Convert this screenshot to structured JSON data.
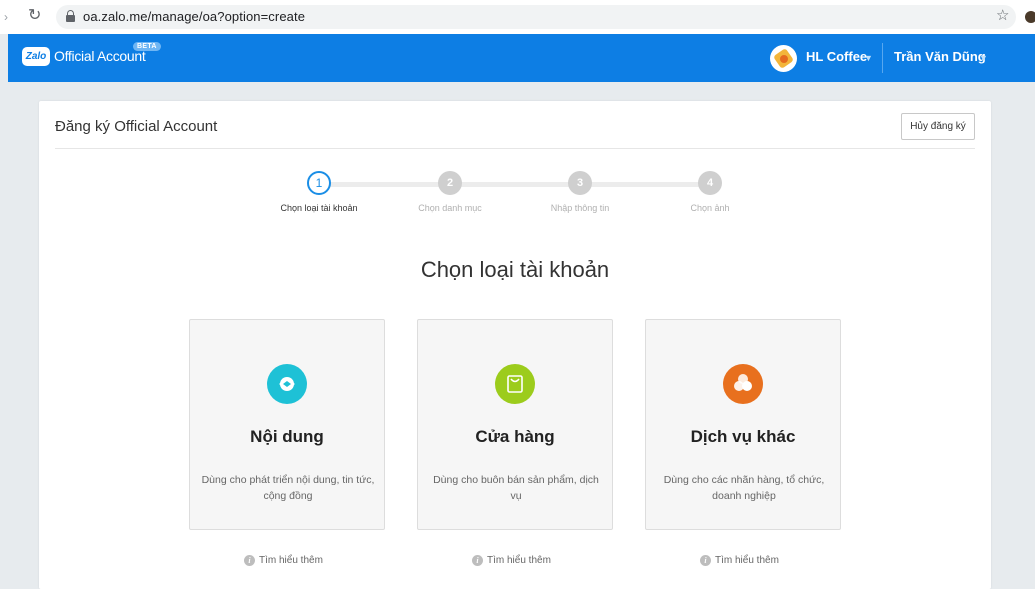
{
  "browser": {
    "url": "oa.zalo.me/manage/oa?option=create"
  },
  "appbar": {
    "logo": "Zalo",
    "brand": "Official Account",
    "beta": "BETA",
    "page_name": "HL Coffee",
    "user_name": "Trần Văn Dũng"
  },
  "card": {
    "title": "Đăng ký Official Account",
    "cancel_label": "Hủy đăng ký"
  },
  "stepper": {
    "steps": [
      {
        "number": "1",
        "label": "Chọn loại tài khoản"
      },
      {
        "number": "2",
        "label": "Chọn danh mục"
      },
      {
        "number": "3",
        "label": "Nhập thông tin"
      },
      {
        "number": "4",
        "label": "Chọn ảnh"
      }
    ],
    "active_step": 1
  },
  "section": {
    "title": "Chọn loại tài khoản"
  },
  "options": [
    {
      "name": "Nội dung",
      "desc": "Dùng cho phát triển nội dung, tin tức, cộng đồng",
      "learn_more": "Tìm hiểu thêm",
      "color": "#1ec1d6"
    },
    {
      "name": "Cửa hàng",
      "desc": "Dùng cho buôn bán sản phẩm, dịch vụ",
      "learn_more": "Tìm hiểu thêm",
      "color": "#9ccc1c"
    },
    {
      "name": "Dịch vụ khác",
      "desc": "Dùng cho các nhãn hàng, tổ chức, doanh nghiệp",
      "learn_more": "Tìm hiểu thêm",
      "color": "#e8701e"
    }
  ],
  "colors": {
    "appbar": "#0d7ee4",
    "active_step": "#1a8ee6"
  }
}
